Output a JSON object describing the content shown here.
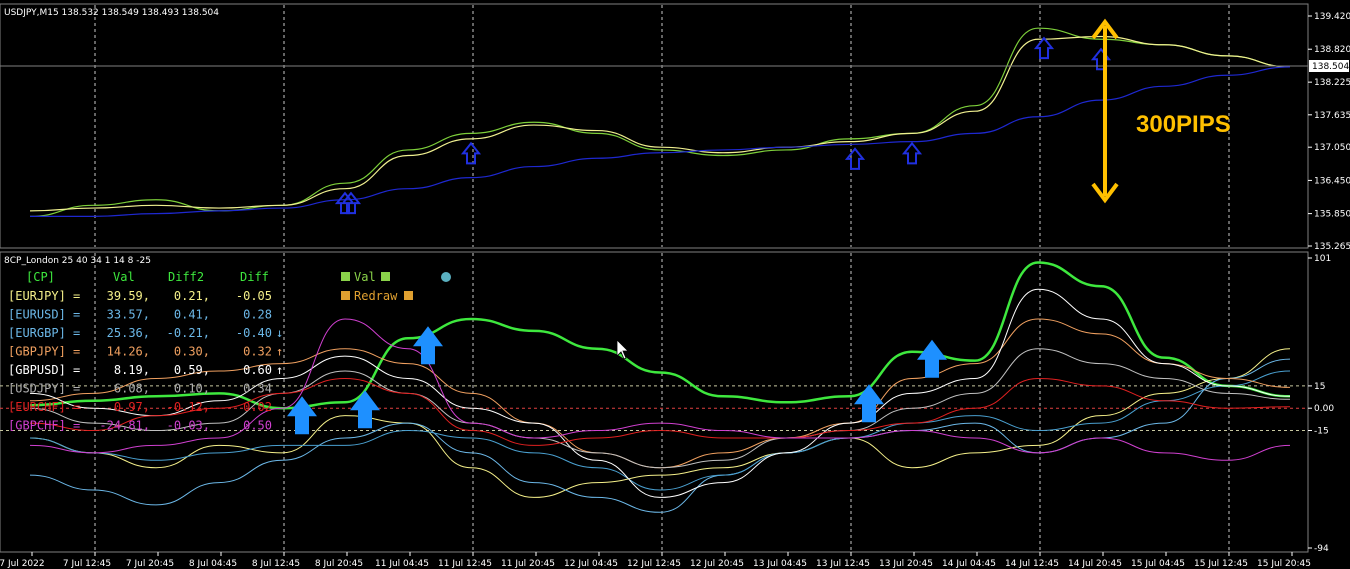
{
  "price_panel": {
    "header": "USDJPY,M15  138.532 138.549 138.493 138.504",
    "y_ticks": [
      "139.420",
      "138.820",
      "138.225",
      "137.635",
      "137.050",
      "136.450",
      "135.850",
      "135.265"
    ],
    "ylim": [
      135.265,
      139.42
    ],
    "current_price": "138.504",
    "annotation": "300PIPS"
  },
  "indicator_panel": {
    "header": "8CP_London 25 40 34 1 14 8 -25",
    "y_ticks": [
      "101",
      "15",
      "0.00",
      "-15",
      "-94"
    ],
    "ylim": [
      -94,
      101
    ],
    "table_header": [
      "[CP]",
      "Val",
      "Diff2",
      "Diff"
    ],
    "rows": [
      {
        "name": "[EURJPY] =",
        "val": "39.59,",
        "diff2": "0.21,",
        "diff": "-0.05",
        "arrow": "",
        "color": "#f5f08a"
      },
      {
        "name": "[EURUSD] =",
        "val": "33.57,",
        "diff2": "0.41,",
        "diff": "0.28",
        "arrow": "",
        "color": "#6cb8e8"
      },
      {
        "name": "[EURGBP] =",
        "val": "25.36,",
        "diff2": "-0.21,",
        "diff": "-0.40",
        "arrow": "↓",
        "color": "#6cb8e8"
      },
      {
        "name": "[GBPJPY] =",
        "val": "14.26,",
        "diff2": "0.30,",
        "diff": "0.32",
        "arrow": "↑",
        "color": "#f0a060"
      },
      {
        "name": "[GBPUSD] =",
        "val": "8.19,",
        "diff2": "0.59,",
        "diff": "0.60",
        "arrow": "↑",
        "color": "#ffffff"
      },
      {
        "name": "[USDJPY] =",
        "val": "6.08,",
        "diff2": "0.10,",
        "diff": "0.34",
        "arrow": "",
        "color": "#b0b0b0"
      },
      {
        "name": "[EURCHF] =",
        "val": "0.97,",
        "diff2": "-0.12,",
        "diff": "0.02",
        "arrow": "",
        "color": "#e02020"
      },
      {
        "name": "[GBPCHF] =",
        "val": "-24.81,",
        "diff2": "-0.03,",
        "diff": "0.50",
        "arrow": "",
        "color": "#d040d0"
      }
    ],
    "legend": [
      {
        "label": "Val",
        "color": "#8bd34a"
      },
      {
        "label": "Redraw",
        "color": "#e0a030"
      }
    ]
  },
  "x_labels": [
    "7 Jul 2022",
    "7 Jul 12:45",
    "7 Jul 20:45",
    "8 Jul 04:45",
    "8 Jul 12:45",
    "8 Jul 20:45",
    "11 Jul 04:45",
    "11 Jul 12:45",
    "11 Jul 20:45",
    "12 Jul 04:45",
    "12 Jul 12:45",
    "12 Jul 20:45",
    "13 Jul 04:45",
    "13 Jul 12:45",
    "13 Jul 20:45",
    "14 Jul 04:45",
    "14 Jul 12:45",
    "14 Jul 20:45",
    "15 Jul 04:45",
    "15 Jul 12:45",
    "15 Jul 20:45"
  ],
  "chart_data": {
    "type": "line",
    "x": [
      "7 Jul 2022",
      "7 Jul 12:45",
      "7 Jul 20:45",
      "8 Jul 04:45",
      "8 Jul 12:45",
      "8 Jul 20:45",
      "11 Jul 04:45",
      "11 Jul 12:45",
      "11 Jul 20:45",
      "12 Jul 04:45",
      "12 Jul 12:45",
      "12 Jul 20:45",
      "13 Jul 04:45",
      "13 Jul 12:45",
      "13 Jul 20:45",
      "14 Jul 04:45",
      "14 Jul 12:45",
      "14 Jul 20:45",
      "15 Jul 04:45",
      "15 Jul 12:45",
      "15 Jul 20:45"
    ],
    "price_series": [
      {
        "values": [
          135.8,
          136.0,
          136.1,
          135.9,
          136.0,
          136.4,
          137.0,
          137.3,
          137.5,
          137.3,
          137.0,
          136.9,
          137.0,
          137.2,
          137.3,
          137.8,
          139.2,
          139.0,
          138.9,
          138.7,
          138.5
        ],
        "color": "#7dcf3a"
      },
      {
        "values": [
          135.9,
          135.95,
          136.0,
          135.95,
          136.0,
          136.3,
          136.9,
          137.2,
          137.45,
          137.35,
          137.05,
          136.95,
          137.05,
          137.15,
          137.3,
          137.7,
          139.0,
          139.05,
          138.9,
          138.7,
          138.5
        ],
        "color": "#f0f090"
      },
      {
        "values": [
          135.8,
          135.8,
          135.85,
          135.9,
          135.95,
          136.1,
          136.3,
          136.5,
          136.7,
          136.85,
          136.95,
          137.0,
          137.05,
          137.1,
          137.15,
          137.3,
          137.6,
          137.9,
          138.15,
          138.35,
          138.5
        ],
        "color": "#1e28d0"
      }
    ],
    "indicator_series": [
      {
        "values": [
          2,
          5,
          8,
          10,
          0,
          4,
          47,
          60,
          52,
          40,
          24,
          8,
          4,
          8,
          38,
          32,
          98,
          82,
          34,
          15,
          8
        ],
        "color": "#3ee83e"
      },
      {
        "values": [
          -20,
          -30,
          -40,
          -25,
          -30,
          -5,
          -10,
          -40,
          -60,
          -50,
          -45,
          -40,
          -30,
          -20,
          -40,
          -30,
          -25,
          -5,
          10,
          20,
          40
        ],
        "color": "#f5f08a"
      },
      {
        "values": [
          -45,
          -55,
          -65,
          -50,
          -35,
          -20,
          -10,
          -30,
          -50,
          -60,
          -70,
          -45,
          -30,
          -20,
          -15,
          -10,
          -30,
          -20,
          -10,
          20,
          33
        ],
        "color": "#6cb8e8"
      },
      {
        "values": [
          -20,
          -30,
          -35,
          -30,
          -25,
          -25,
          -15,
          -20,
          -30,
          -40,
          -55,
          -45,
          -30,
          -20,
          -10,
          -5,
          -15,
          -10,
          5,
          15,
          25
        ],
        "color": "#4aa0d0"
      },
      {
        "values": [
          5,
          10,
          20,
          25,
          30,
          40,
          30,
          10,
          -10,
          -30,
          -40,
          -30,
          -20,
          -10,
          20,
          30,
          60,
          50,
          30,
          20,
          14
        ],
        "color": "#f0a060"
      },
      {
        "values": [
          10,
          0,
          -5,
          5,
          20,
          35,
          20,
          0,
          -10,
          -35,
          -60,
          -50,
          -30,
          -10,
          10,
          20,
          80,
          60,
          30,
          15,
          8
        ],
        "color": "#ffffff"
      },
      {
        "values": [
          0,
          -10,
          -15,
          -10,
          10,
          25,
          10,
          -10,
          -20,
          -30,
          -40,
          -35,
          -20,
          -15,
          0,
          10,
          40,
          30,
          20,
          10,
          6
        ],
        "color": "#c0c0c0"
      },
      {
        "values": [
          -10,
          -15,
          -5,
          0,
          10,
          20,
          10,
          -15,
          -25,
          -20,
          -15,
          -20,
          -20,
          -15,
          -10,
          0,
          20,
          15,
          5,
          0,
          1
        ],
        "color": "#e02020"
      },
      {
        "values": [
          -25,
          -30,
          -25,
          -20,
          0,
          60,
          40,
          -10,
          -20,
          -15,
          -10,
          -15,
          -20,
          -20,
          -15,
          -20,
          -30,
          -20,
          -30,
          -35,
          -25
        ],
        "color": "#d040d0"
      }
    ],
    "signal_arrows_price": [
      5,
      5,
      7,
      13,
      14,
      16,
      17
    ],
    "signal_arrows_indicator": [
      4,
      5,
      6,
      13,
      14
    ],
    "ylim_price": [
      135.265,
      139.42
    ],
    "ylim_indicator": [
      -94,
      101
    ]
  }
}
